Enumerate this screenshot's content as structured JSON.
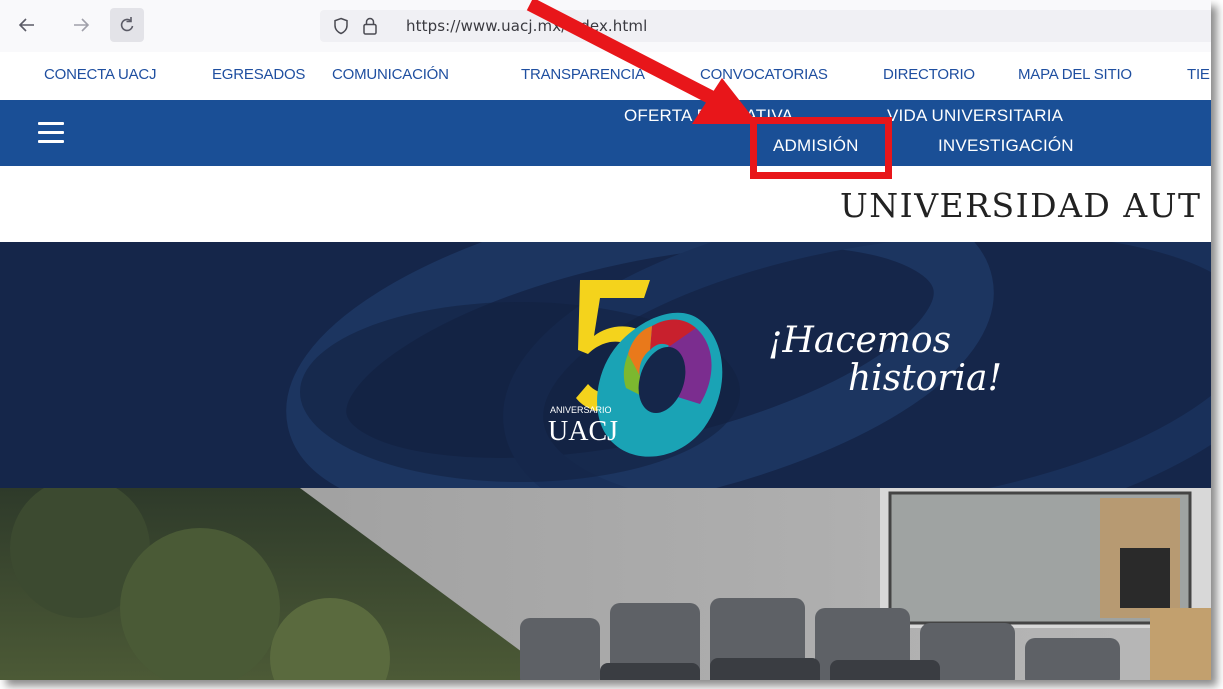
{
  "browser": {
    "url": "https://www.uacj.mx/index.html",
    "back_icon": "arrow-left-icon",
    "forward_icon": "arrow-right-icon",
    "reload_icon": "reload-icon"
  },
  "top_links": [
    "CONECTA UACJ",
    "EGRESADOS",
    "COMUNICACIÓN",
    "TRANSPARENCIA",
    "CONVOCATORIAS",
    "DIRECTORIO",
    "MAPA DEL SITIO",
    "TIE"
  ],
  "main_nav": {
    "oferta": "OFERTA EDUCATIVA",
    "vida": "VIDA UNIVERSITARIA",
    "admision": "ADMISIÓN",
    "investigacion": "INVESTIGACIÓN"
  },
  "site_title": "UNIVERSIDAD AUT",
  "banner": {
    "logo_aniversario": "ANIVERSARIO",
    "logo_uacj": "UACJ",
    "slogan_line1": "¡Hacemos",
    "slogan_line2": "historia!"
  },
  "colors": {
    "nav_blue": "#1a4f96",
    "link_blue": "#1f4fa0",
    "banner_navy": "#15264a",
    "annotation_red": "#e8161a"
  }
}
